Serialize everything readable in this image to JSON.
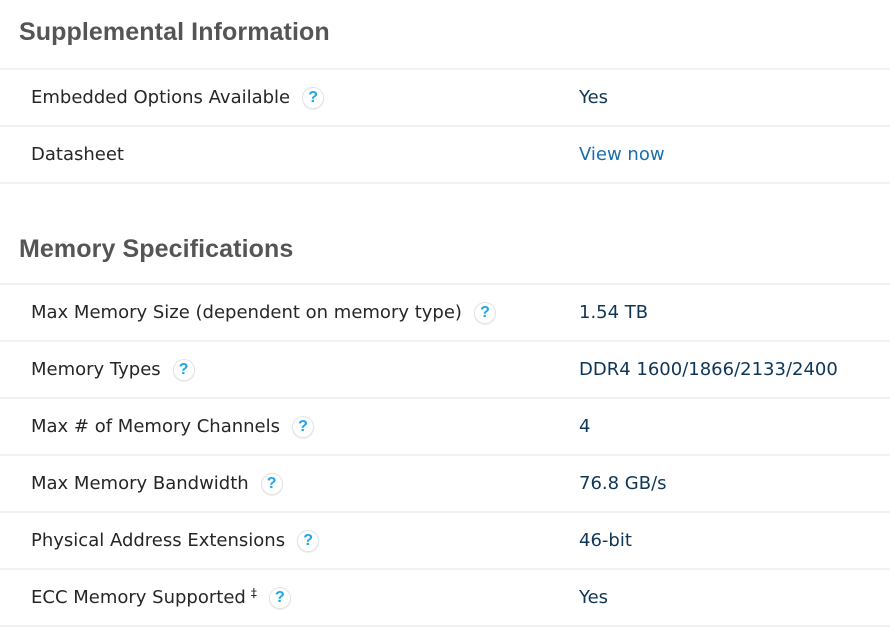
{
  "sections": [
    {
      "title": "Supplemental Information",
      "rows": [
        {
          "label": "Embedded Options Available",
          "has_help": true,
          "value": "Yes",
          "is_link": false
        },
        {
          "label": "Datasheet",
          "has_help": false,
          "value": "View now",
          "is_link": true
        }
      ]
    },
    {
      "title": "Memory Specifications",
      "rows": [
        {
          "label": "Max Memory Size (dependent on memory type)",
          "has_help": true,
          "value": "1.54 TB",
          "is_link": false
        },
        {
          "label": "Memory Types",
          "has_help": true,
          "value": "DDR4 1600/1866/2133/2400",
          "is_link": false
        },
        {
          "label": "Max # of Memory Channels",
          "has_help": true,
          "value": "4",
          "is_link": false
        },
        {
          "label": "Max Memory Bandwidth",
          "has_help": true,
          "value": "76.8 GB/s",
          "is_link": false
        },
        {
          "label": "Physical Address Extensions",
          "has_help": true,
          "value": "46-bit",
          "is_link": false
        },
        {
          "label": "ECC Memory Supported",
          "footnote": "‡",
          "has_help": true,
          "value": "Yes",
          "is_link": false
        }
      ]
    }
  ],
  "icons": {
    "help": "?"
  },
  "colors": {
    "heading": "#555555",
    "label": "#262626",
    "value": "#0e3657",
    "link": "#1a6fad",
    "help_icon": "#1ea6e6",
    "divider": "#f1f1f1"
  }
}
